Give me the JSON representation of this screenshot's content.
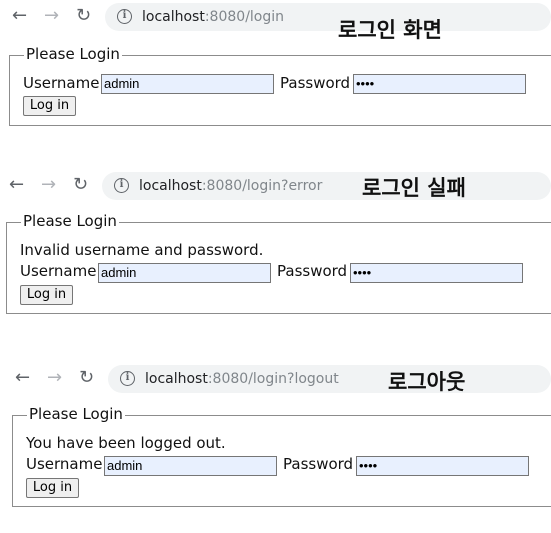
{
  "panels": [
    {
      "url_host": "localhost",
      "url_path": ":8080/login",
      "caption": "로그인 화면",
      "legend": "Please Login",
      "message": "",
      "username_label": "Username",
      "username_value": "admin",
      "password_label": "Password",
      "password_value": "••••",
      "login_button": "Log in"
    },
    {
      "url_host": "localhost",
      "url_path": ":8080/login?error",
      "caption": "로그인 실패",
      "legend": "Please Login",
      "message": "Invalid username and password.",
      "username_label": "Username",
      "username_value": "admin",
      "password_label": "Password",
      "password_value": "••••",
      "login_button": "Log in"
    },
    {
      "url_host": "localhost",
      "url_path": ":8080/login?logout",
      "caption": "로그아웃",
      "legend": "Please Login",
      "message": "You have been logged out.",
      "username_label": "Username",
      "username_value": "admin",
      "password_label": "Password",
      "password_value": "••••",
      "login_button": "Log in"
    }
  ],
  "icons": {
    "back": "arrow-left-icon",
    "forward": "arrow-right-icon",
    "reload": "reload-icon",
    "info": "info-icon"
  },
  "colors": {
    "autofill": "#e8f0fe",
    "address_bar": "#f1f3f4",
    "path_text": "#80868b"
  }
}
